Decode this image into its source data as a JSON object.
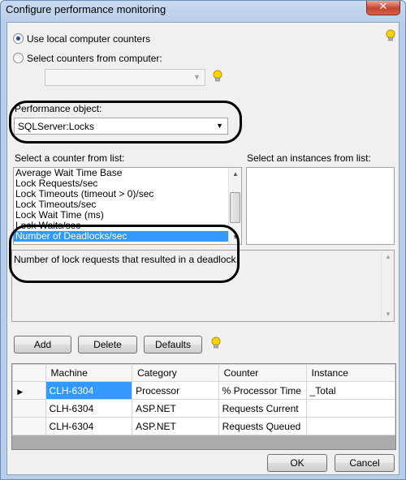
{
  "window": {
    "title": "Configure performance monitoring",
    "close_glyph": "✕"
  },
  "source": {
    "local_label": "Use local computer counters",
    "remote_label": "Select counters from computer:",
    "selected": "local",
    "computer_value": ""
  },
  "performance_object": {
    "label": "Performance object:",
    "value": "SQLServer:Locks"
  },
  "counters": {
    "label": "Select a counter from list:",
    "items": [
      "Average Wait Time Base",
      "Lock Requests/sec",
      "Lock Timeouts (timeout > 0)/sec",
      "Lock Timeouts/sec",
      "Lock Wait Time (ms)",
      "Lock Waits/sec",
      "Number of Deadlocks/sec"
    ],
    "selected_index": 6
  },
  "instances": {
    "label": "Select an instances from list:",
    "items": []
  },
  "description": "Number of lock requests that resulted in a deadlock.",
  "actions": {
    "add": "Add",
    "delete": "Delete",
    "defaults": "Defaults"
  },
  "grid": {
    "columns": [
      "Machine",
      "Category",
      "Counter",
      "Instance"
    ],
    "rows": [
      {
        "machine": "CLH-6304",
        "category": "Processor",
        "counter": "% Processor Time",
        "instance": "_Total",
        "current": true
      },
      {
        "machine": "CLH-6304",
        "category": "ASP.NET",
        "counter": "Requests Current",
        "instance": "",
        "current": false
      },
      {
        "machine": "CLH-6304",
        "category": "ASP.NET",
        "counter": "Requests Queued",
        "instance": "",
        "current": false
      }
    ]
  },
  "footer": {
    "ok": "OK",
    "cancel": "Cancel"
  },
  "icons": {
    "hint": "lightbulb-icon",
    "dropdown": "chevron-down-icon",
    "row_pointer": "row-pointer-icon"
  },
  "colors": {
    "selection": "#3399ff",
    "close_button": "#c7442f",
    "hint_bulb": "#ffd400",
    "annotation": "#000000"
  }
}
